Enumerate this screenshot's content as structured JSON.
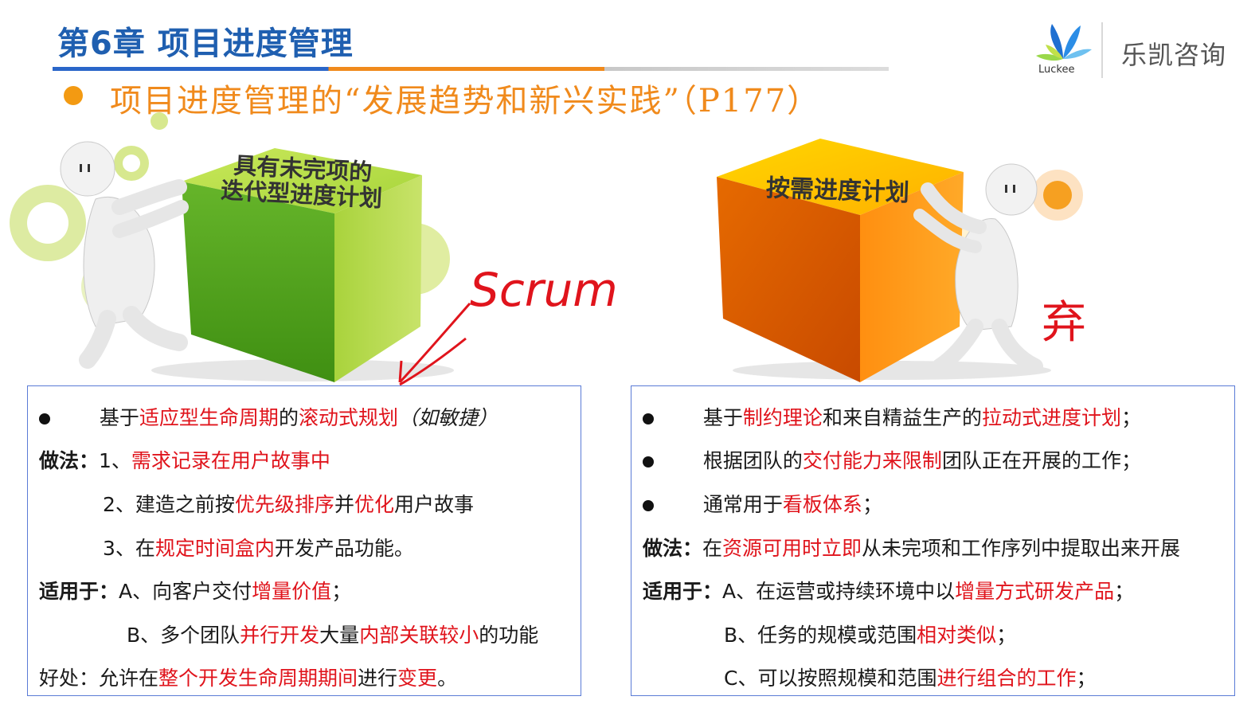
{
  "header": {
    "chapter_title": "第6章 项目进度管理",
    "subtitle": "项目进度管理的“发展趋势和新兴实践”（P177）"
  },
  "logo": {
    "name": "乐凯咨询",
    "wordmark": "Luckee"
  },
  "left_cube": {
    "label_line1": "具有未完项的",
    "label_line2": "迭代型进度计划"
  },
  "right_cube": {
    "label": "按需进度计划"
  },
  "annotations": {
    "left_handwriting": "Scrum",
    "right_handwriting": "弃"
  },
  "left_box": {
    "bullet1": {
      "p1": "基于",
      "r1": "适应型生命周期",
      "p2": "的",
      "r2": "滚动式规划",
      "p3": "（如敏捷）"
    },
    "method_label": "做法：",
    "m1": {
      "p1": "1、",
      "r1": "需求记录在用户故事中"
    },
    "m2": {
      "p1": "2、建造之前按",
      "r1": "优先级排序",
      "p2": "并",
      "r2": "优化",
      "p3": "用户故事"
    },
    "m3": {
      "p1": "3、在",
      "r1": "规定时间盒内",
      "p2": "开发产品功能。"
    },
    "apply_label": "适用于：",
    "a1": {
      "p1": "A、向客户交付",
      "r1": "增量价值",
      "p2": "；"
    },
    "a2": {
      "p1": "B、多个团队",
      "r1": "并行开发",
      "p2": "大量",
      "r2": "内部关联较小",
      "p3": "的功能"
    },
    "benefit": {
      "p1": "好处：允许在",
      "r1": "整个开发生命周期期间",
      "p2": "进行",
      "r2": "变更",
      "p3": "。"
    }
  },
  "right_box": {
    "b1": {
      "p1": "基于",
      "r1": "制约理论",
      "p2": "和来自精益生产的",
      "r2": "拉动式进度计划",
      "p3": "；"
    },
    "b2": {
      "p1": "根据团队的",
      "r1": "交付能力来限制",
      "p2": "团队正在开展的工作；"
    },
    "b3": {
      "p1": "通常用于",
      "r1": "看板体系",
      "p2": "；"
    },
    "method_label": "做法：",
    "m1": {
      "p1": "在",
      "r1": "资源可用时立即",
      "p2": "从未完项和工作序列中提取出来开展"
    },
    "apply_label": "适用于：",
    "a1": {
      "p1": "A、在运营或持续环境中以",
      "r1": "增量方式研发产品",
      "p2": "；"
    },
    "a2": {
      "p1": "B、任务的规模或范围",
      "r1": "相对类似",
      "p2": "；"
    },
    "a3": {
      "p1": "C、可以按照规模和范围",
      "r1": "进行组合的工作",
      "p2": "；"
    }
  }
}
